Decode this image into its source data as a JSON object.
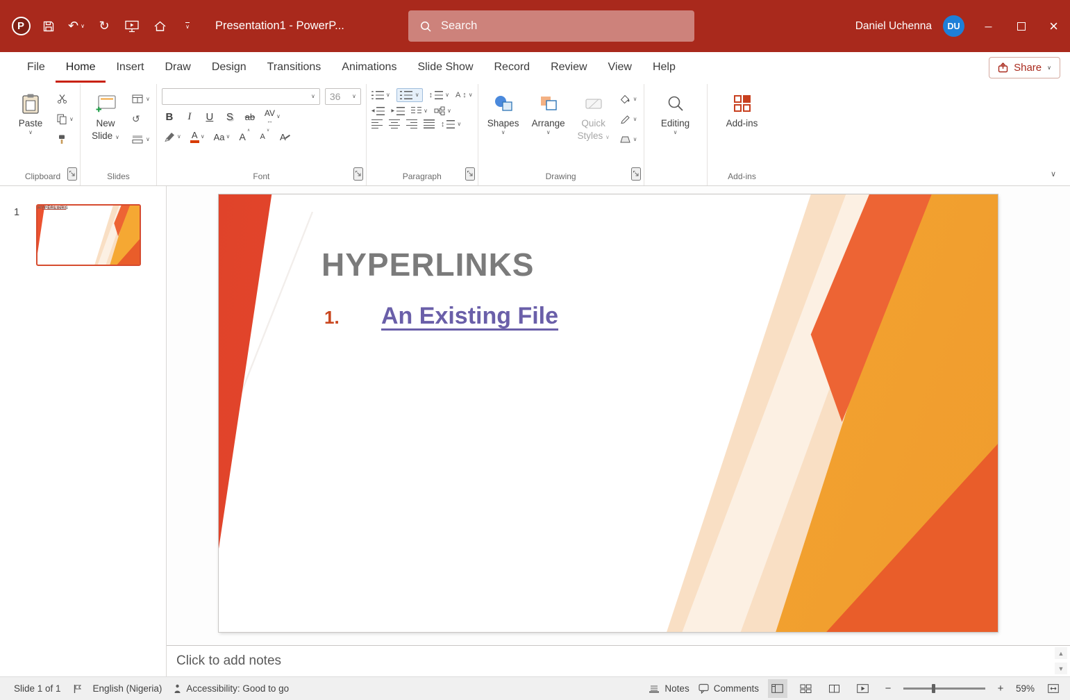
{
  "titlebar": {
    "doc_title": "Presentation1  -  PowerP...",
    "search_placeholder": "Search",
    "user_name": "Daniel Uchenna",
    "user_initials": "DU"
  },
  "tabs": [
    "File",
    "Home",
    "Insert",
    "Draw",
    "Design",
    "Transitions",
    "Animations",
    "Slide Show",
    "Record",
    "Review",
    "View",
    "Help"
  ],
  "share_label": "Share",
  "ribbon": {
    "clipboard": {
      "paste": "Paste",
      "group": "Clipboard"
    },
    "slides": {
      "new_slide": "New Slide",
      "group": "Slides"
    },
    "font": {
      "font_size": "36",
      "bold": "B",
      "italic": "I",
      "underline": "U",
      "shadow": "S",
      "strikethrough": "ab",
      "char_spacing": "AV",
      "change_case": "Aa",
      "grow": "A",
      "shrink": "A",
      "clear": "A",
      "group": "Font"
    },
    "paragraph": {
      "group": "Paragraph"
    },
    "drawing": {
      "shapes": "Shapes",
      "arrange": "Arrange",
      "quick_styles": "Quick Styles",
      "group": "Drawing"
    },
    "editing_label": "Editing",
    "addins_label": "Add-ins",
    "addins_group": "Add-ins"
  },
  "slides_panel": {
    "slide_number": "1"
  },
  "slide": {
    "title": "HYPERLINKS",
    "list_number": "1.",
    "link_text": "An Existing File"
  },
  "notes_placeholder": "Click to add notes",
  "statusbar": {
    "slide_indicator": "Slide 1 of 1",
    "language": "English (Nigeria)",
    "accessibility": "Accessibility: Good to go",
    "notes_label": "Notes",
    "comments_label": "Comments",
    "zoom_level": "59%"
  },
  "icons": {
    "logo_letter": "P",
    "chevron_down": "∨",
    "chevron_up": "∧",
    "undo": "↶",
    "redo": "↻",
    "reset": "↺",
    "updown": "↕",
    "left_right": "↔",
    "letter_a": "A",
    "triangle_left": "◀",
    "triangle_right": "▶",
    "arrow_up": "▲",
    "arrow_down": "▼",
    "minus": "−",
    "plus": "+",
    "close": "×",
    "minimize": "─"
  }
}
